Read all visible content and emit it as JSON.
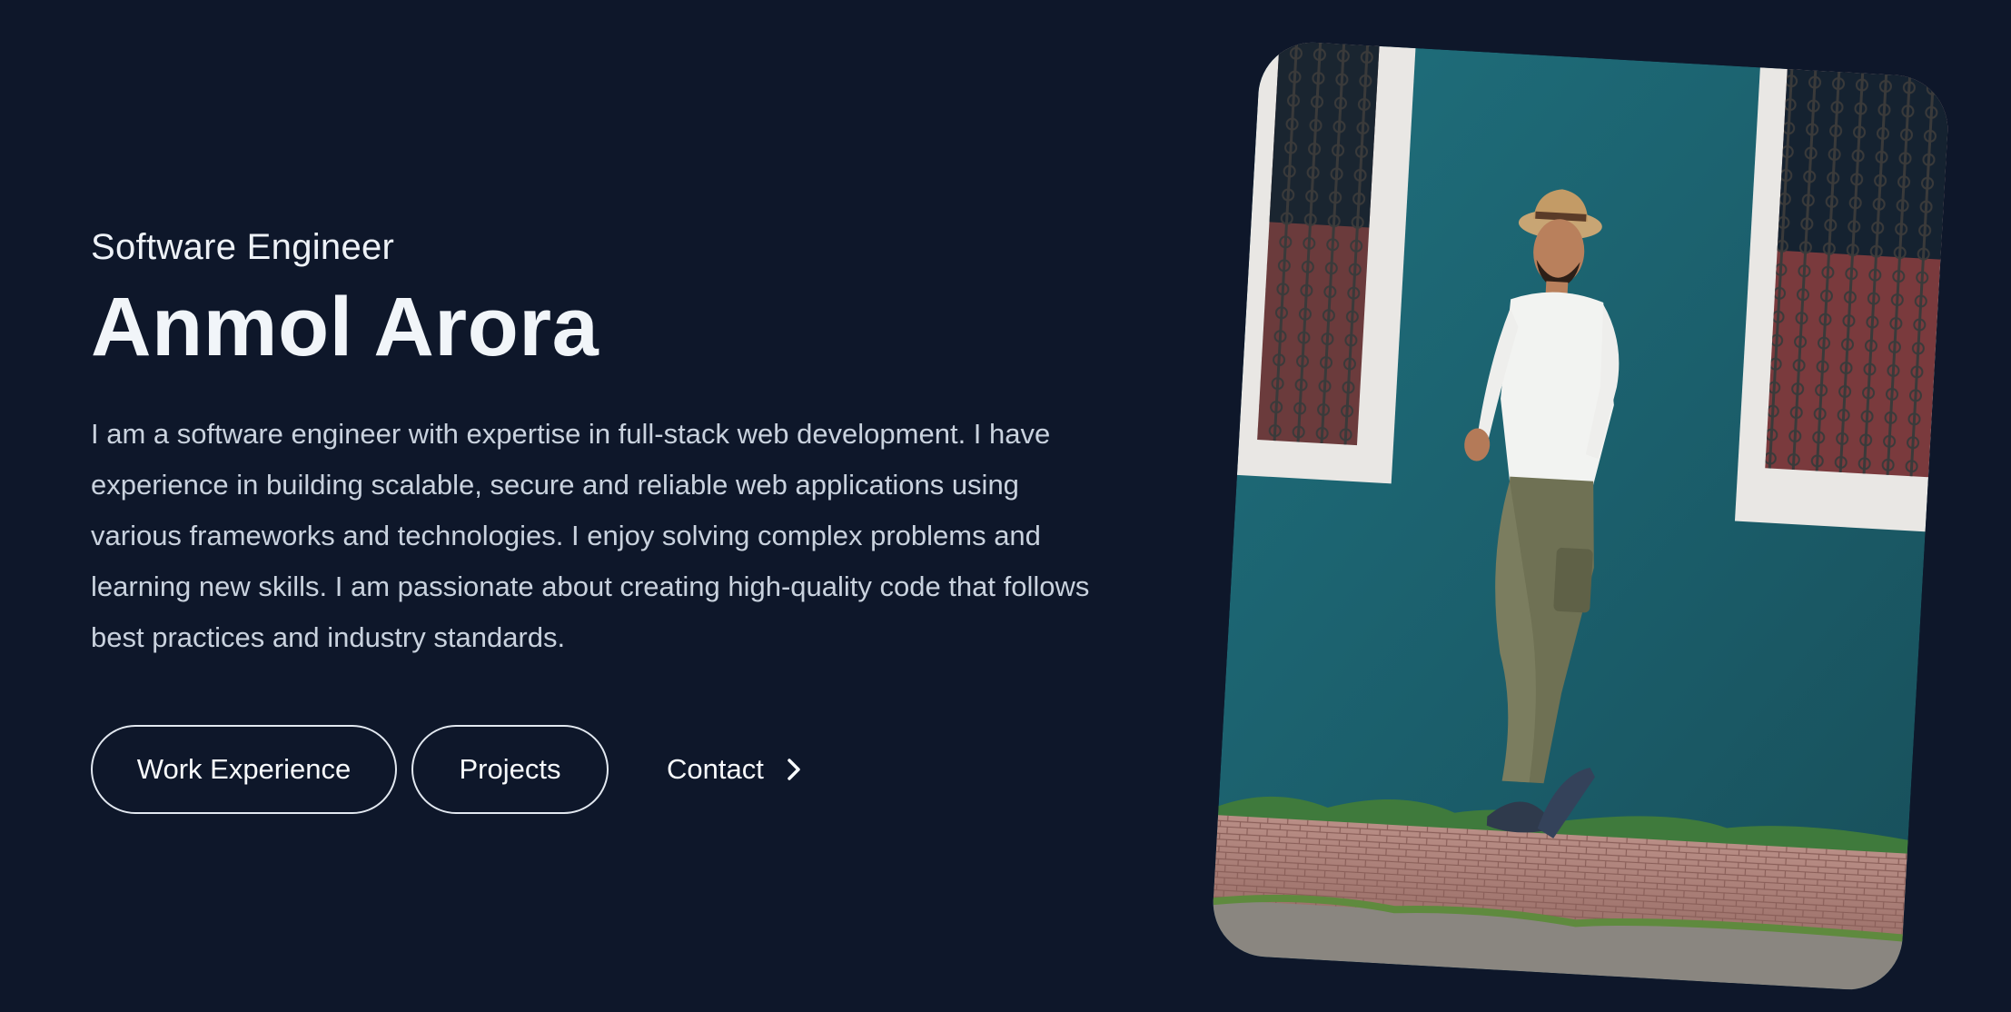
{
  "hero": {
    "role": "Software Engineer",
    "name": "Anmol Arora",
    "bio": "I am a software engineer with expertise in full-stack web development. I have experience in building scalable, secure and reliable web applications using various frameworks and technologies. I enjoy solving complex problems and learning new skills. I am passionate about creating high-quality code that follows best practices and industry standards."
  },
  "actions": {
    "work_label": "Work Experience",
    "projects_label": "Projects",
    "contact_label": "Contact",
    "contact_icon": "chevron-right-icon"
  },
  "colors": {
    "background": "#0e172a",
    "heading": "#f1f5f9",
    "body_text": "#c9d2de",
    "button_border": "#e2e8f0"
  }
}
